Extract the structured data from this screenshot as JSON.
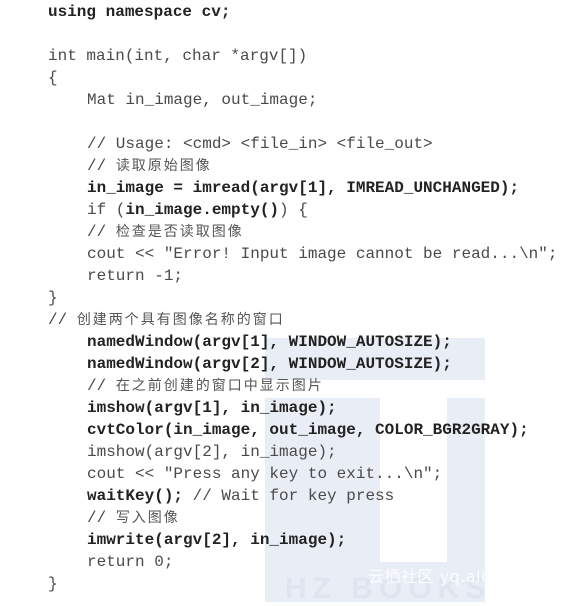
{
  "listing": {
    "lines": [
      {
        "indent": 0,
        "segments": [
          {
            "t": "using namespace cv;",
            "bold": true
          }
        ]
      },
      {
        "indent": 0,
        "segments": []
      },
      {
        "indent": 0,
        "segments": [
          {
            "t": "int main(int, char *argv[])",
            "bold": false
          }
        ]
      },
      {
        "indent": 0,
        "segments": [
          {
            "t": "{",
            "bold": false
          }
        ]
      },
      {
        "indent": 1,
        "segments": [
          {
            "t": "Mat in_image, out_image;",
            "bold": false
          }
        ]
      },
      {
        "indent": 1,
        "segments": []
      },
      {
        "indent": 1,
        "segments": [
          {
            "t": "// Usage: <cmd> <file_in> <file_out>",
            "bold": false
          }
        ]
      },
      {
        "indent": 1,
        "segments": [
          {
            "t": "// ",
            "bold": false
          },
          {
            "t": "读取原始图像",
            "cjk": true
          }
        ]
      },
      {
        "indent": 1,
        "segments": [
          {
            "t": "in_image = imread(argv[1], IMREAD_UNCHANGED);",
            "bold": true
          }
        ]
      },
      {
        "indent": 1,
        "segments": [
          {
            "t": "if (",
            "bold": false
          },
          {
            "t": "in_image.empty()",
            "bold": true
          },
          {
            "t": ") {",
            "bold": false
          }
        ]
      },
      {
        "indent": 1,
        "segments": [
          {
            "t": "// ",
            "bold": false
          },
          {
            "t": "检查是否读取图像",
            "cjk": true
          }
        ]
      },
      {
        "indent": 1,
        "segments": [
          {
            "t": "cout << \"Error! Input image cannot be read...\\n\";",
            "bold": false
          }
        ]
      },
      {
        "indent": 1,
        "segments": [
          {
            "t": "return -1;",
            "bold": false
          }
        ]
      },
      {
        "indent": 0,
        "segments": [
          {
            "t": "}",
            "bold": false
          }
        ]
      },
      {
        "indent": 0,
        "segments": [
          {
            "t": "// ",
            "bold": false
          },
          {
            "t": "创建两个具有图像名称的窗口",
            "cjk": true
          }
        ]
      },
      {
        "indent": 1,
        "segments": [
          {
            "t": "namedWindow(argv[1], WINDOW_AUTOSIZE);",
            "bold": true
          }
        ]
      },
      {
        "indent": 1,
        "segments": [
          {
            "t": "namedWindow(argv[2], WINDOW_AUTOSIZE);",
            "bold": true
          }
        ]
      },
      {
        "indent": 1,
        "segments": [
          {
            "t": "// ",
            "bold": false
          },
          {
            "t": "在之前创建的窗口中显示图片",
            "cjk": true
          }
        ]
      },
      {
        "indent": 1,
        "segments": [
          {
            "t": "imshow(argv[1], in_image);",
            "bold": true
          }
        ]
      },
      {
        "indent": 1,
        "segments": [
          {
            "t": "cvtColor(in_image, out_image, COLOR_BGR2GRAY);",
            "bold": true
          }
        ]
      },
      {
        "indent": 1,
        "segments": [
          {
            "t": "imshow(argv[2], in_image);",
            "bold": false
          }
        ]
      },
      {
        "indent": 1,
        "segments": [
          {
            "t": "cout << \"Press any key to exit...\\n\";",
            "bold": false
          }
        ]
      },
      {
        "indent": 1,
        "segments": [
          {
            "t": "waitKey();",
            "bold": true
          },
          {
            "t": " // Wait for key press",
            "bold": false
          }
        ]
      },
      {
        "indent": 1,
        "segments": [
          {
            "t": "// ",
            "bold": false
          },
          {
            "t": "写入图像",
            "cjk": true
          }
        ]
      },
      {
        "indent": 1,
        "segments": [
          {
            "t": "imwrite(argv[2], in_image);",
            "bold": true
          }
        ]
      },
      {
        "indent": 1,
        "segments": [
          {
            "t": "return 0;",
            "bold": false
          }
        ]
      },
      {
        "indent": 0,
        "segments": [
          {
            "t": "}",
            "bold": false
          }
        ]
      }
    ]
  },
  "watermark": {
    "site_text": "云栖社区 yq.aliyun.com",
    "logo_text": "HZ BOOKS"
  },
  "colors": {
    "text": "#3a3a3a",
    "watermark_bg": "#e9edf5"
  }
}
